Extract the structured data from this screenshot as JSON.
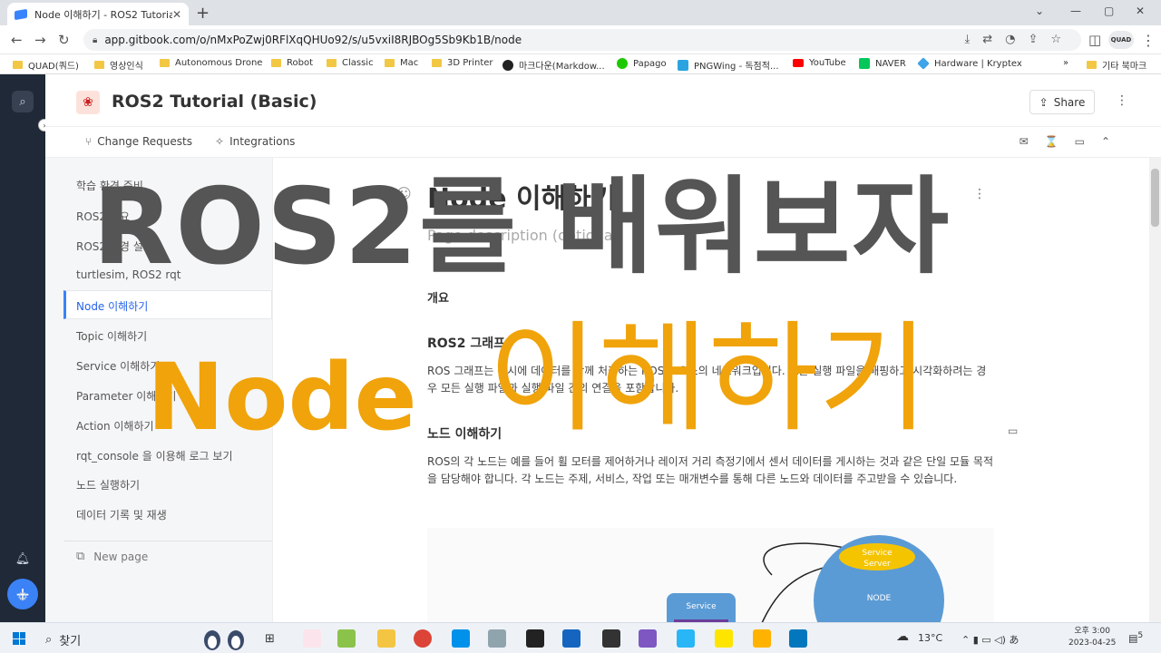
{
  "browser": {
    "tab_title": "Node 이해하기 - ROS2 Tutorial",
    "url": "app.gitbook.com/o/nMxPoZwj0RFlXqQHUo92/s/u5vxiI8RJBOg5Sb9Kb1B/node",
    "profile_label": "QUAD"
  },
  "bookmarks": [
    {
      "label": "QUAD(쿼드)",
      "icon": "folder"
    },
    {
      "label": "영상인식",
      "icon": "folder"
    },
    {
      "label": "Autonomous Drone",
      "icon": "folder"
    },
    {
      "label": "Robot",
      "icon": "folder"
    },
    {
      "label": "Classic",
      "icon": "folder"
    },
    {
      "label": "Mac",
      "icon": "folder"
    },
    {
      "label": "3D Printer",
      "icon": "folder"
    },
    {
      "label": "마크다운(Markdow...",
      "icon": "github-icon"
    },
    {
      "label": "Papago",
      "icon": "papago-icon"
    },
    {
      "label": "PNGWing - 독점적...",
      "icon": "pngwing-icon"
    },
    {
      "label": "YouTube",
      "icon": "youtube-icon"
    },
    {
      "label": "NAVER",
      "icon": "naver-icon"
    },
    {
      "label": "Hardware | Kryptex",
      "icon": "kryptex-icon"
    }
  ],
  "bookmarks_more": "»",
  "bookmarks_other": "기타 북마크",
  "gitbook": {
    "space_title": "ROS2 Tutorial (Basic)",
    "share_label": "Share",
    "change_requests": "Change Requests",
    "integrations": "Integrations"
  },
  "sidebar": {
    "items": [
      "학습 환경 준비",
      "ROS2 개요",
      "ROS2 환경 설정",
      "turtlesim, ROS2 rqt",
      "Node 이해하기",
      "Topic 이해하기",
      "Service 이해하기",
      "Parameter 이해하기",
      "Action 이해하기",
      "rqt_console 을 이용해 로그 보기",
      "노드 실행하기",
      "데이터 기록 및 재생"
    ],
    "new_page": "New page"
  },
  "page": {
    "title": "Node 이해하기",
    "description": "Page description (optional)",
    "section_label": "개요",
    "h2_graph": "ROS2 그래프",
    "para_graph": "ROS 그래프는 동시에 데이터를 함께 처리하는 ROS 2 요소의 네트워크입니다. 모든 실행 파일을 매핑하고 시각화하려는 경우 모든 실행 파일과 실행 파일 간의 연결을 포함합니다.",
    "h2_node": "노드 이해하기",
    "para_node": "ROS의 각 노드는 예를 들어 휠 모터를 제어하거나 레이저 거리 측정기에서 센서 데이터를 게시하는 것과 같은 단일 모듈 목적을 담당해야 합니다. 각 노드는 주제, 서비스, 작업 또는 매개변수를 통해 다른 노드와 데이터를 주고받을 수 있습니다."
  },
  "diagram": {
    "service_server_label": "Service\nServer",
    "service_server_line1": "Service",
    "service_server_line2": "Server",
    "node_label": "NODE",
    "service_label": "Service"
  },
  "overlay": {
    "line1": "ROS2를 배워보자",
    "line2_en": "Node",
    "line2_ko": "이해하기",
    "accent_color": "#f0a30a"
  },
  "taskbar": {
    "search_label": "찾기",
    "weather": "13°C",
    "time": "오후 3:00",
    "date": "2023-04-25",
    "notifications": "5"
  }
}
